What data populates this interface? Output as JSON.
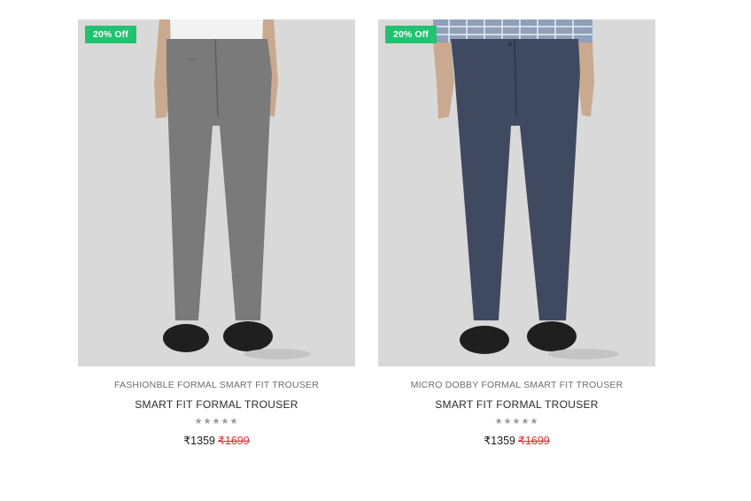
{
  "colors": {
    "badge_bg": "#21c270",
    "old_price": "#e03030",
    "image_bg": "#d9d9d9"
  },
  "products": [
    {
      "badge": "20% Off",
      "subtitle": "FASHIONBLE FORMAL SMART FIT TROUSER",
      "title": "SMART FIT FORMAL TROUSER",
      "stars": "★★★★★",
      "rating_stars_total": 5,
      "price": "₹1359",
      "old_price": "₹1699",
      "trouser_color": "#7a7a7a",
      "shirt_color": "#f2f2f2"
    },
    {
      "badge": "20% Off",
      "subtitle": "MICRO DOBBY FORMAL SMART FIT TROUSER",
      "title": "SMART FIT FORMAL TROUSER",
      "stars": "★★★★★",
      "rating_stars_total": 5,
      "price": "₹1359",
      "old_price": "₹1699",
      "trouser_color": "#3f4a60",
      "shirt_color": "#8fa0b8"
    }
  ]
}
